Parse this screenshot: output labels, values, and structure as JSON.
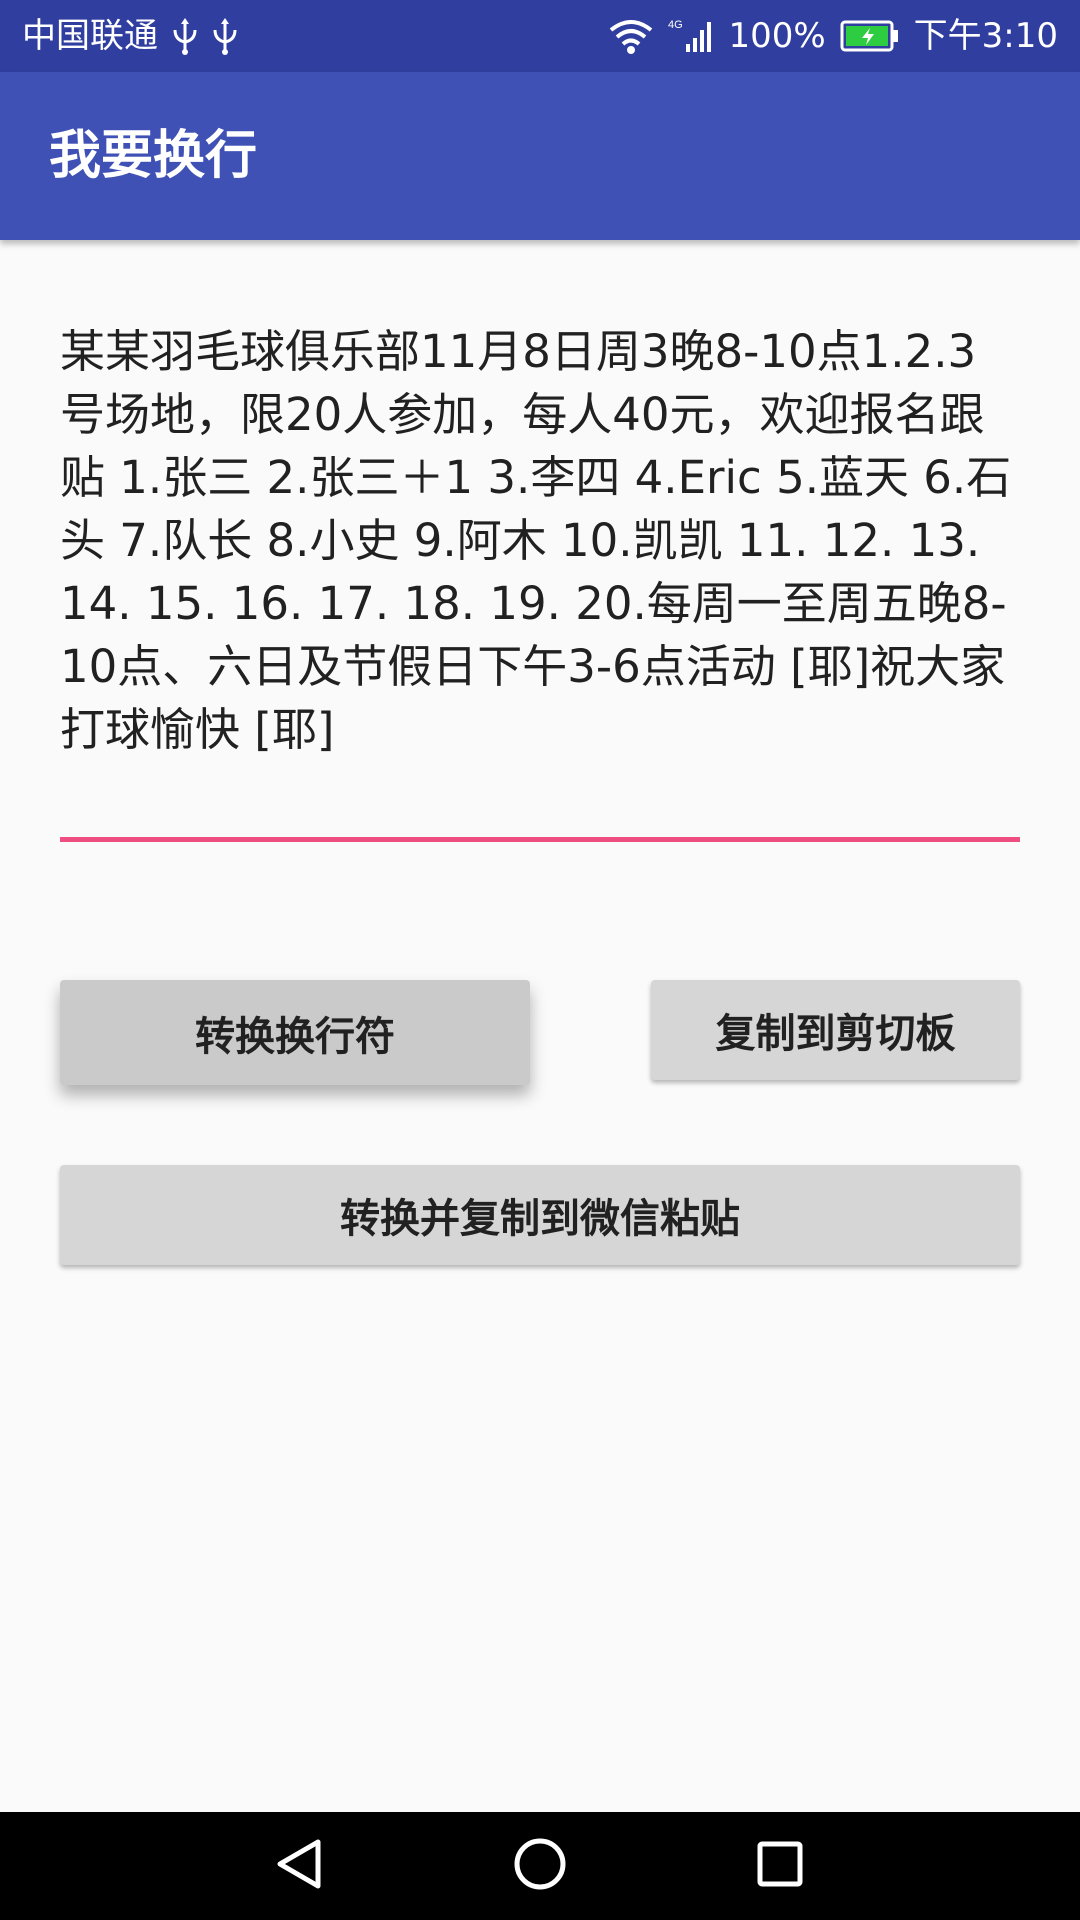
{
  "status_bar": {
    "carrier": "中国联通",
    "battery_percent": "100%",
    "time": "下午3:10",
    "network_type": "4G",
    "icons": [
      "usb-icon",
      "usb-icon",
      "wifi-icon",
      "signal-icon",
      "battery-icon"
    ]
  },
  "app_bar": {
    "title": "我要换行"
  },
  "editor": {
    "text": "某某羽毛球俱乐部11月8日周3晚8-10点1.2.3号场地，限20人参加，每人40元，欢迎报名跟贴 1.张三 2.张三＋1 3.李四 4.Eric 5.蓝天 6.石头 7.队长 8.小史 9.阿木 10.凯凯 11. 12. 13. 14. 15. 16. 17. 18. 19. 20.每周一至周五晚8-10点、六日及节假日下午3-6点活动 [耶]祝大家打球愉快 [耶]"
  },
  "buttons": {
    "convert_label": "转换换行符",
    "copy_label": "复制到剪切板",
    "convert_copy_wechat_label": "转换并复制到微信粘贴"
  },
  "nav_bar": {
    "icons": [
      "back-icon",
      "home-icon",
      "recent-apps-icon"
    ]
  },
  "colors": {
    "status_bar": "#303f9f",
    "app_bar": "#3f51b5",
    "accent": "#ee4e80",
    "button": "#d6d6d6",
    "background": "#fafafa"
  }
}
